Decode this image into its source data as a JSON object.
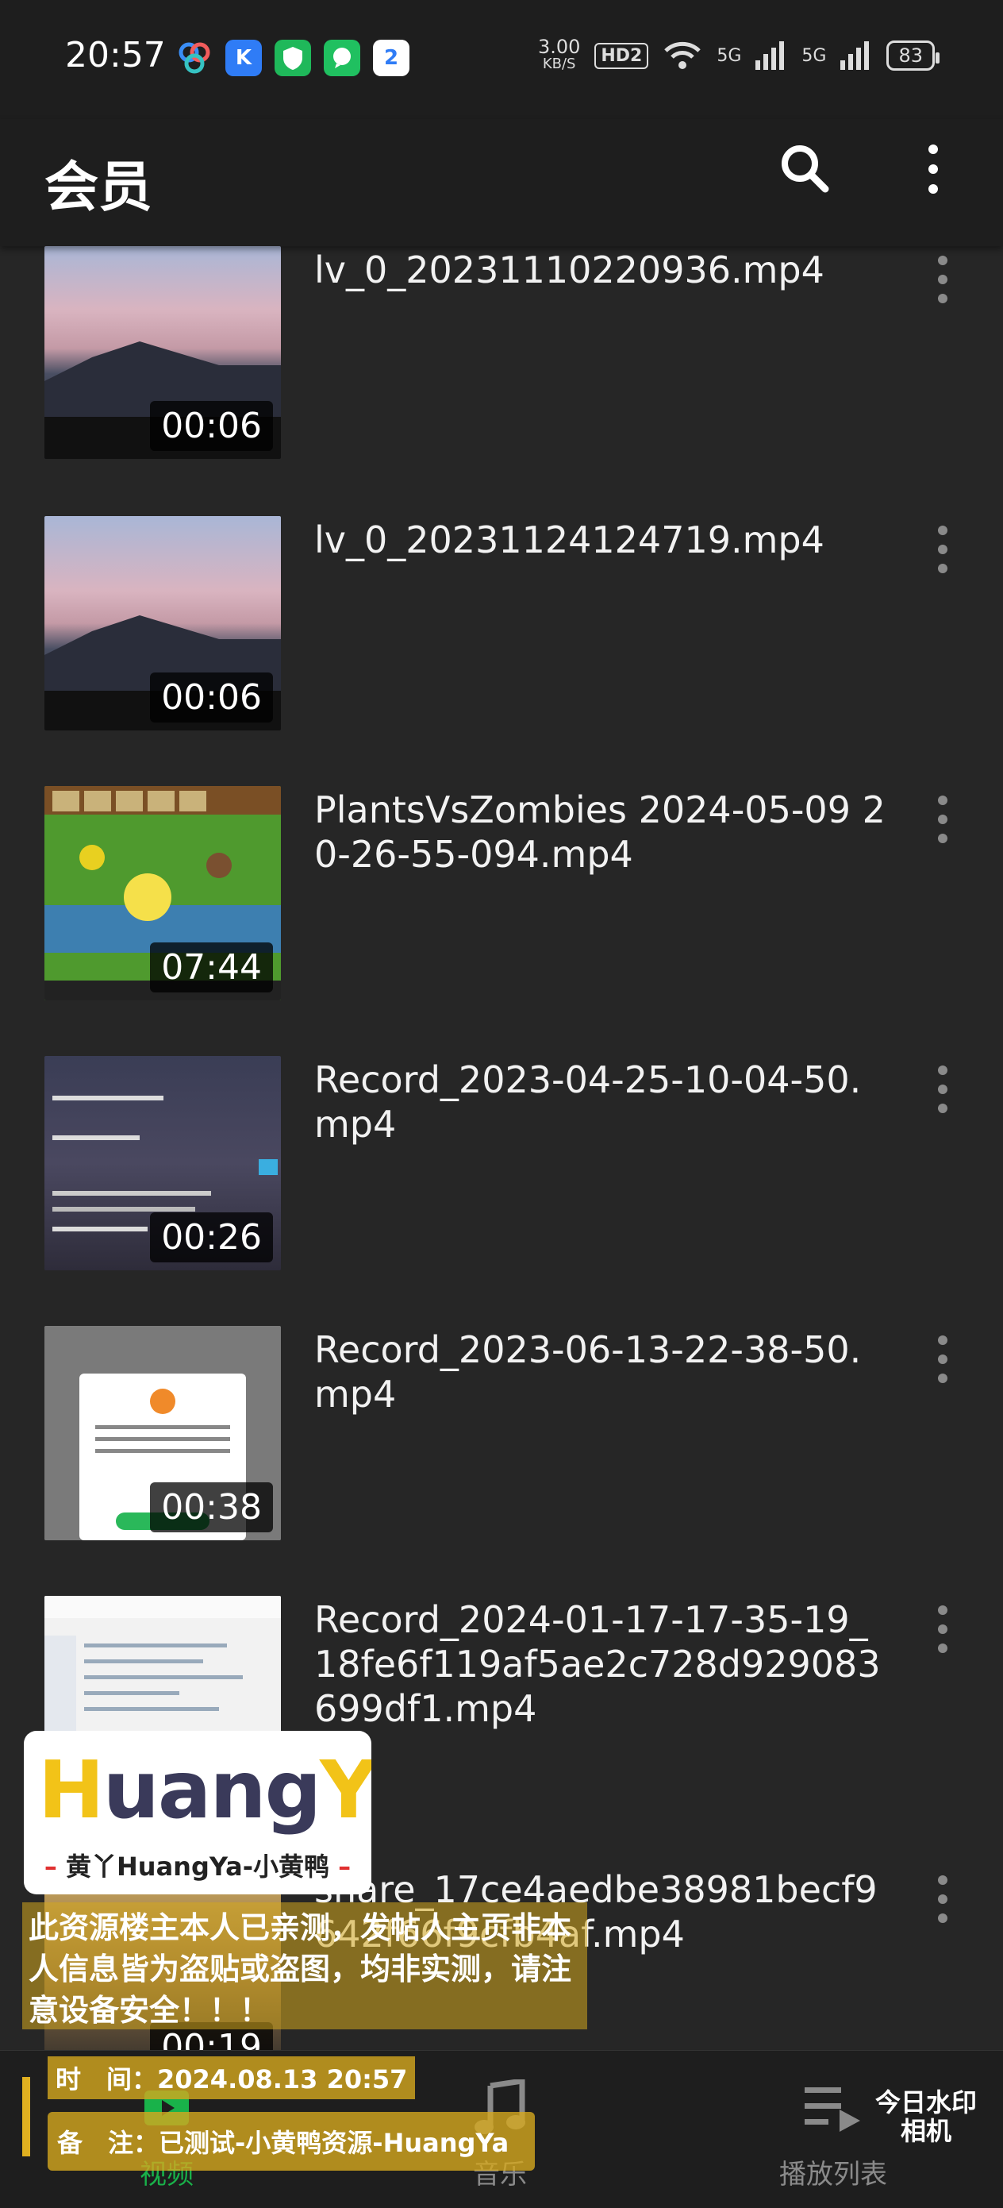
{
  "status_bar": {
    "time": "20:57",
    "speed_value": "3.00",
    "speed_unit": "KB/S",
    "hd_label": "HD2",
    "net1": "5G",
    "net2": "5G",
    "battery": "83",
    "app_icons": [
      "baidu-netdisk-icon",
      "k-app-icon",
      "shield-app-icon",
      "chat-app-icon",
      "browser-app-icon"
    ]
  },
  "app_bar": {
    "title": "会员",
    "icons": [
      "search-icon",
      "more-vert-icon"
    ]
  },
  "videos": [
    {
      "name": "lv_0_20231110220936.mp4",
      "duration": "00:06"
    },
    {
      "name": "lv_0_20231124124719.mp4",
      "duration": "00:06"
    },
    {
      "name": "PlantsVsZombies 2024-05-09 20-26-55-094.mp4",
      "duration": "07:44"
    },
    {
      "name": "Record_2023-04-25-10-04-50.mp4",
      "duration": "00:26"
    },
    {
      "name": "Record_2023-06-13-22-38-50.mp4",
      "duration": "00:38"
    },
    {
      "name": "Record_2024-01-17-17-35-19_18fe6f119af5ae2c728d929083699df1.mp4",
      "duration": ""
    },
    {
      "name": "share_17ce4aedbe38981becf9642f66f9cfb4af.mp4",
      "duration": "00:19"
    }
  ],
  "bottom_nav": [
    {
      "label": "视频",
      "icon": "video-icon",
      "active": true
    },
    {
      "label": "音乐",
      "icon": "music-note-icon",
      "active": false
    },
    {
      "label": "播放列表",
      "icon": "playlist-icon",
      "active": false
    }
  ],
  "watermark": {
    "logo_text": "HuangYa",
    "logo_sub": "黄丫HuangYa-小黄鸭",
    "notice": "此资源楼主本人已亲测，发帖人主页非本人信息皆为盗贴或盗图，均非实测，请注意设备安全！！！",
    "time": "时　间：2024.08.13 20:57",
    "remark": "备　注：已测试-小黄鸭资源-HuangYa",
    "camera": "今日水印相机"
  },
  "colors": {
    "background": "#262626",
    "bar": "#1e1e1e",
    "accent": "#19b24a",
    "watermark": "#d4a81e"
  }
}
